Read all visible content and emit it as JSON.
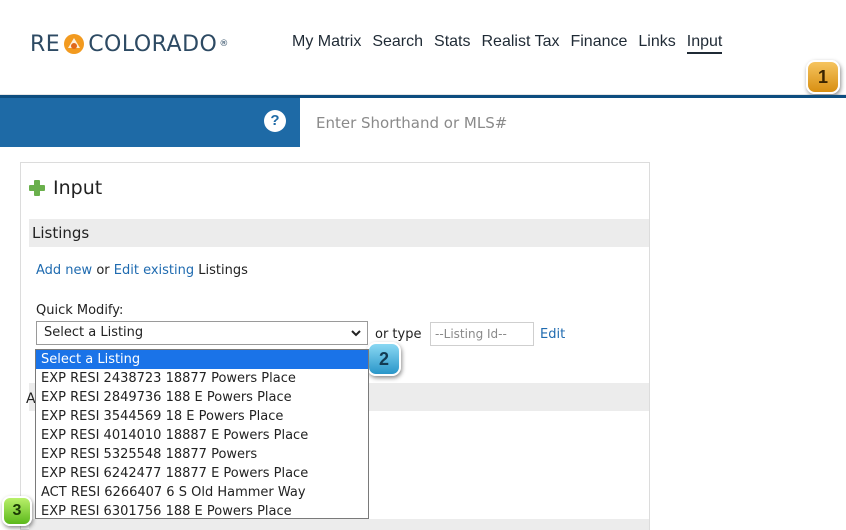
{
  "logo": {
    "left": "RE",
    "right": "COLORADO",
    "mark": "®"
  },
  "nav": [
    "My Matrix",
    "Search",
    "Stats",
    "Realist Tax",
    "Finance",
    "Links",
    "Input"
  ],
  "nav_active": "Input",
  "search": {
    "placeholder": "Enter Shorthand or MLS#",
    "help": "?"
  },
  "panel": {
    "title": "Input",
    "listings_header": "Listings",
    "add_new": "Add new",
    "or_text": "or",
    "edit_existing": "Edit existing",
    "listings_word": "Listings",
    "quick_modify_label": "Quick Modify:",
    "select_value": "Select a Listing",
    "or_type": "or type",
    "listing_id_placeholder": "--Listing Id--",
    "edit": "Edit",
    "hidden_header_letter": "A"
  },
  "dropdown_options": [
    "Select a Listing",
    "EXP RESI 2438723 18877 Powers Place",
    "EXP RESI 2849736 188 E Powers Place",
    "EXP RESI 3544569 18 E Powers Place",
    "EXP RESI 4014010 18887 E Powers Place",
    "EXP RESI 5325548 18877 Powers",
    "EXP RESI 6242477 18877 E Powers Place",
    "ACT RESI 6266407 6 S Old Hammer Way",
    "EXP RESI 6301756 188 E Powers Place"
  ],
  "callouts": [
    "1",
    "2",
    "3"
  ],
  "colors": {
    "brand_blue": "#1e6aa6",
    "link": "#1f6bb0",
    "logo_orange": "#f29a1f"
  }
}
